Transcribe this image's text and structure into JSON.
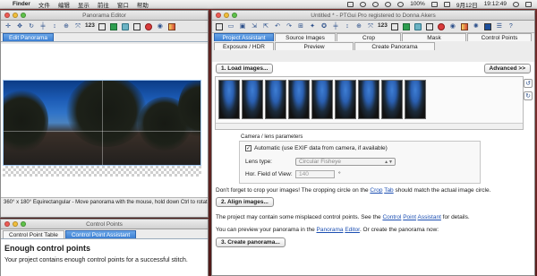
{
  "menubar": {
    "apple": "",
    "items": [
      "Finder",
      "文件",
      "编辑",
      "显示",
      "前往",
      "窗口",
      "帮助"
    ],
    "battery": "100%",
    "datetime": "9月12日",
    "time": "19:12:49"
  },
  "pano_editor": {
    "title": "Panorama Editor",
    "toolbar_label_123": "123",
    "tab": "Edit Panorama",
    "status": "360° x 180° Equirectangular - Move panorama with the mouse, hold down Ctrl to rotate"
  },
  "control_points": {
    "title": "Control Points",
    "tabs": [
      "Control Point Table",
      "Control Point Assistant"
    ],
    "heading": "Enough control points",
    "text": "Your project contains enough control points for a successful stitch."
  },
  "main": {
    "title": "Untitled * - PTGui Pro registered to Donna Akers",
    "toolbar_label_123": "123",
    "tabs_row1": [
      "Project Assistant",
      "Source Images",
      "Crop",
      "Mask",
      "Control Points"
    ],
    "tabs_row2": [
      "Exposure / HDR",
      "Preview",
      "Create Panorama"
    ],
    "load_button": "1. Load images...",
    "advanced_button": "Advanced >>",
    "thumbnail_count": 9,
    "lens_group_title": "Camera / lens parameters",
    "auto_exif_label": "Automatic (use EXIF data from camera, if available)",
    "auto_exif_checked": "✓",
    "lens_type_label": "Lens type:",
    "lens_type_value": "Circular Fisheye",
    "fov_label": "Hor. Field of View:",
    "fov_value": "140",
    "fov_unit": "°",
    "crop_note_1": "Don't forget to crop your images! The cropping circle on the ",
    "crop_note_link": "Crop",
    "crop_note_link2": "Tab",
    "crop_note_2": " should match the actual image circle.",
    "align_button": "2. Align images...",
    "misplaced_1": "The project may contain some misplaced control points. See the ",
    "misplaced_link1": "Control",
    "misplaced_link2": "Point",
    "misplaced_link3": "Assistant",
    "misplaced_2": " for details.",
    "preview_1": "You can preview your panorama in the ",
    "preview_link1": "Panorama",
    "preview_link2": "Editor",
    "preview_2": ". Or create the panorama now:",
    "create_button": "3. Create panorama..."
  }
}
